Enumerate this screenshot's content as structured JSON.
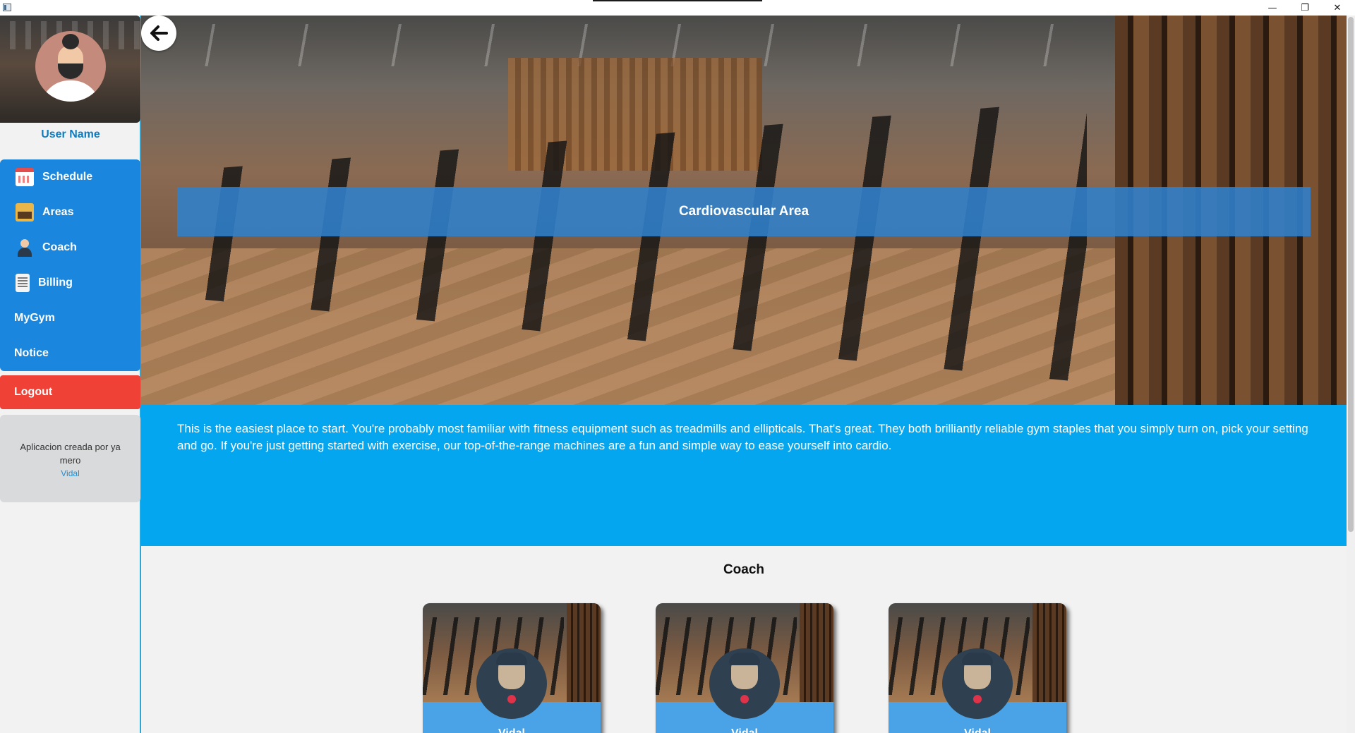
{
  "window": {
    "minimize_icon": "—",
    "restore_icon": "❐",
    "close_icon": "✕"
  },
  "sidebar": {
    "user_name": "User Name",
    "items": [
      {
        "label": "Schedule",
        "icon": "calendar-icon"
      },
      {
        "label": "Areas",
        "icon": "gym-icon"
      },
      {
        "label": "Coach",
        "icon": "coach-icon"
      },
      {
        "label": "Billing",
        "icon": "receipt-icon"
      },
      {
        "label": "MyGym",
        "icon": ""
      },
      {
        "label": "Notice",
        "icon": ""
      }
    ],
    "logout_label": "Logout",
    "credit_text": "Aplicacion creada por ya mero",
    "credit_author": "Vidal"
  },
  "main": {
    "back_icon": "←",
    "area_title": "Cardiovascular Area",
    "description": "This is the easiest place to start. You're probably most familiar with fitness equipment such as treadmills and ellipticals. That's great. They both brilliantly reliable gym staples that you simply turn on, pick your setting and go. If you're just getting started with exercise, our top-of-the-range machines are a fun and simple way to ease yourself into cardio.",
    "coach_section_title": "Coach",
    "coaches": [
      {
        "name": "Vidal"
      },
      {
        "name": "Vidal"
      },
      {
        "name": "Vidal"
      }
    ]
  },
  "colors": {
    "sidebar_blue": "#1a86dd",
    "logout_red": "#ef4136",
    "description_blue": "#04a6ef",
    "banner_blue": "#3081cd"
  }
}
